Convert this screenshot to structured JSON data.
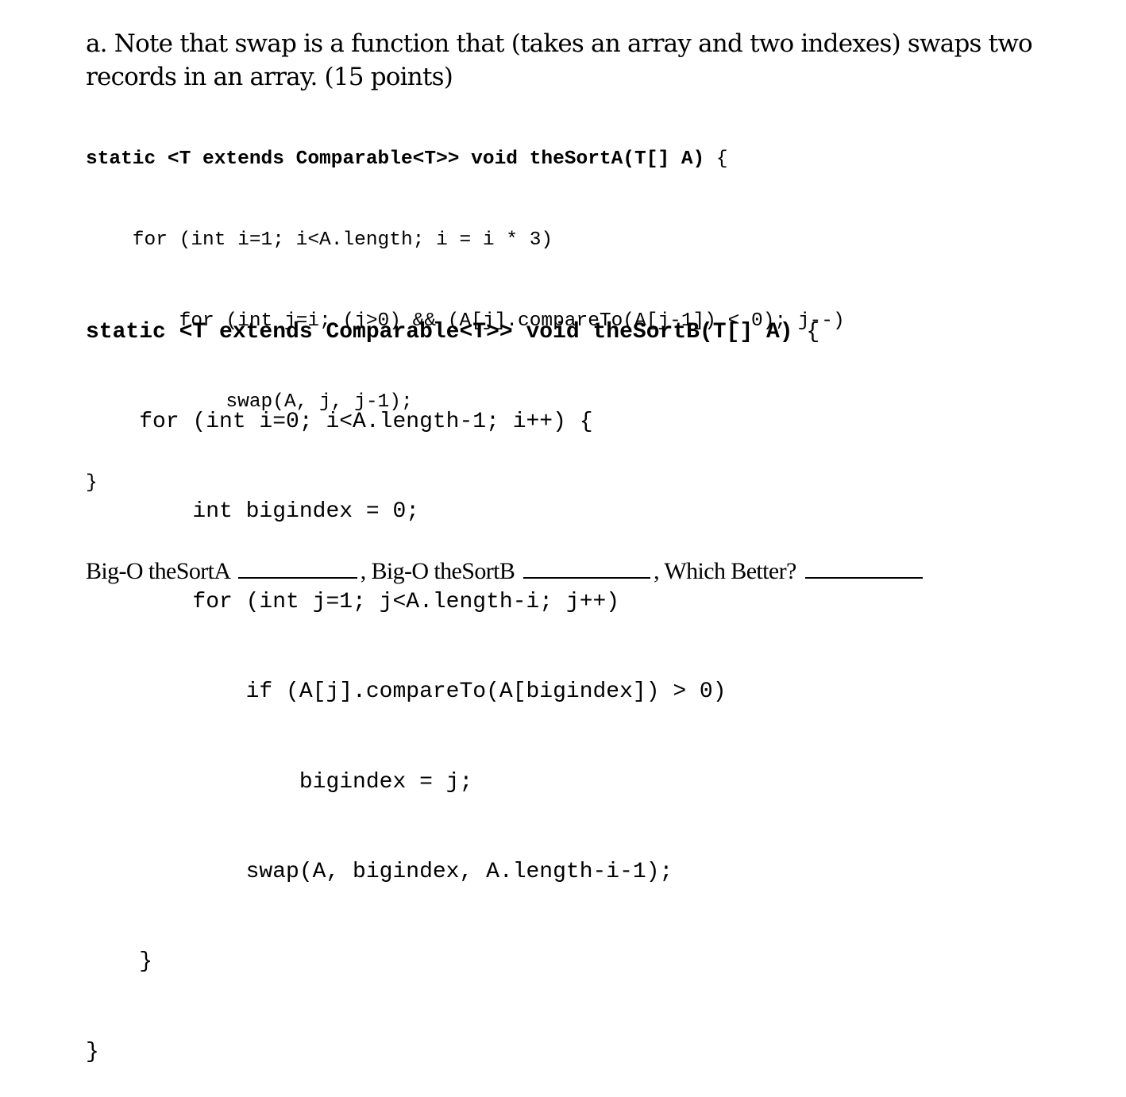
{
  "question": {
    "intro": "a. Note that swap is a function that (takes an array and two indexes) swaps two records in an array. (15 points)"
  },
  "codeA": {
    "signature": "static <T extends Comparable<T>> void theSortA(T[] A)",
    "open_brace": " {",
    "lines": [
      "    for (int i=1; i<A.length; i = i * 3)",
      "        for (int j=i; (j>0) && (A[j].compareTo(A[j-1]) < 0); j--)",
      "            swap(A, j, j-1);",
      "}"
    ]
  },
  "codeB": {
    "signature": "static <T extends Comparable<T>> void theSortB(T[] A)",
    "open_brace": " {",
    "lines": [
      "    for (int i=0; i<A.length-1; i++) {",
      "        int bigindex = 0;",
      "        for (int j=1; j<A.length-i; j++)",
      "            if (A[j].compareTo(A[bigindex]) > 0)",
      "                bigindex = j;",
      "            swap(A, bigindex, A.length-i-1);",
      "    }",
      "}"
    ]
  },
  "answers": {
    "labelA": "Big-O theSortA",
    "labelB": ", Big-O theSortB",
    "labelC": ", Which Better?",
    "valueA": "",
    "valueB": "",
    "valueC": ""
  }
}
